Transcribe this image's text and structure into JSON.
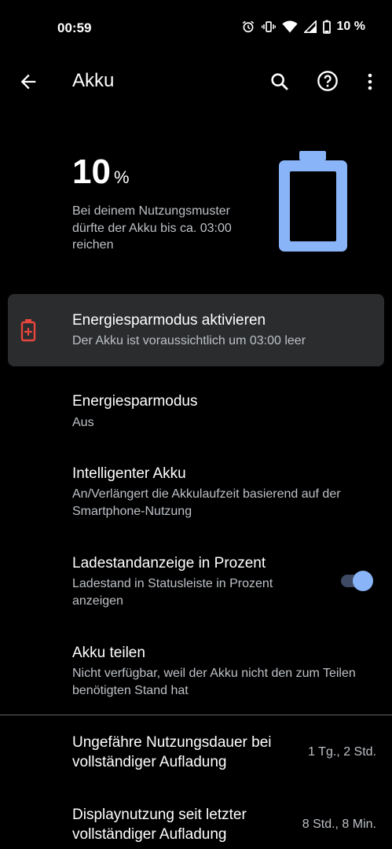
{
  "status_bar": {
    "time": "00:59",
    "battery_text": "10 %"
  },
  "app_bar": {
    "title": "Akku"
  },
  "battery": {
    "level": "10",
    "unit": "%",
    "estimate": "Bei deinem Nutzungsmuster dürfte der Akku bis ca. 03:00 reichen",
    "fill_fraction": 0.1,
    "color": "#8ab4f8"
  },
  "tip": {
    "title": "Energiesparmodus aktivieren",
    "summary": "Der Akku ist voraussichtlich um 03:00 leer",
    "icon_color": "#e8453c"
  },
  "preferences": [
    {
      "title": "Energiesparmodus",
      "summary": "Aus"
    },
    {
      "title": "Intelligenter Akku",
      "summary": "An/Verlängert die Akkulaufzeit basierend auf der Smartphone-Nutzung"
    },
    {
      "title": "Ladestandanzeige in Prozent",
      "summary": "Ladestand in Statusleiste in Prozent anzeigen",
      "toggle_on": true
    },
    {
      "title": "Akku teilen",
      "summary": "Nicht verfügbar, weil der Akku nicht den zum Teilen benötigten Stand hat"
    }
  ],
  "usage": [
    {
      "title": "Ungefähre Nutzungsdauer bei vollständiger Aufladung",
      "value": "1 Tg., 2 Std."
    },
    {
      "title": "Displaynutzung seit letzter vollständiger Aufladung",
      "value": "8 Std., 8 Min."
    }
  ],
  "colors": {
    "background": "#000000",
    "card": "#2b2c2e",
    "accent": "#8ab4f8",
    "secondary_text": "#bdc1c6"
  }
}
